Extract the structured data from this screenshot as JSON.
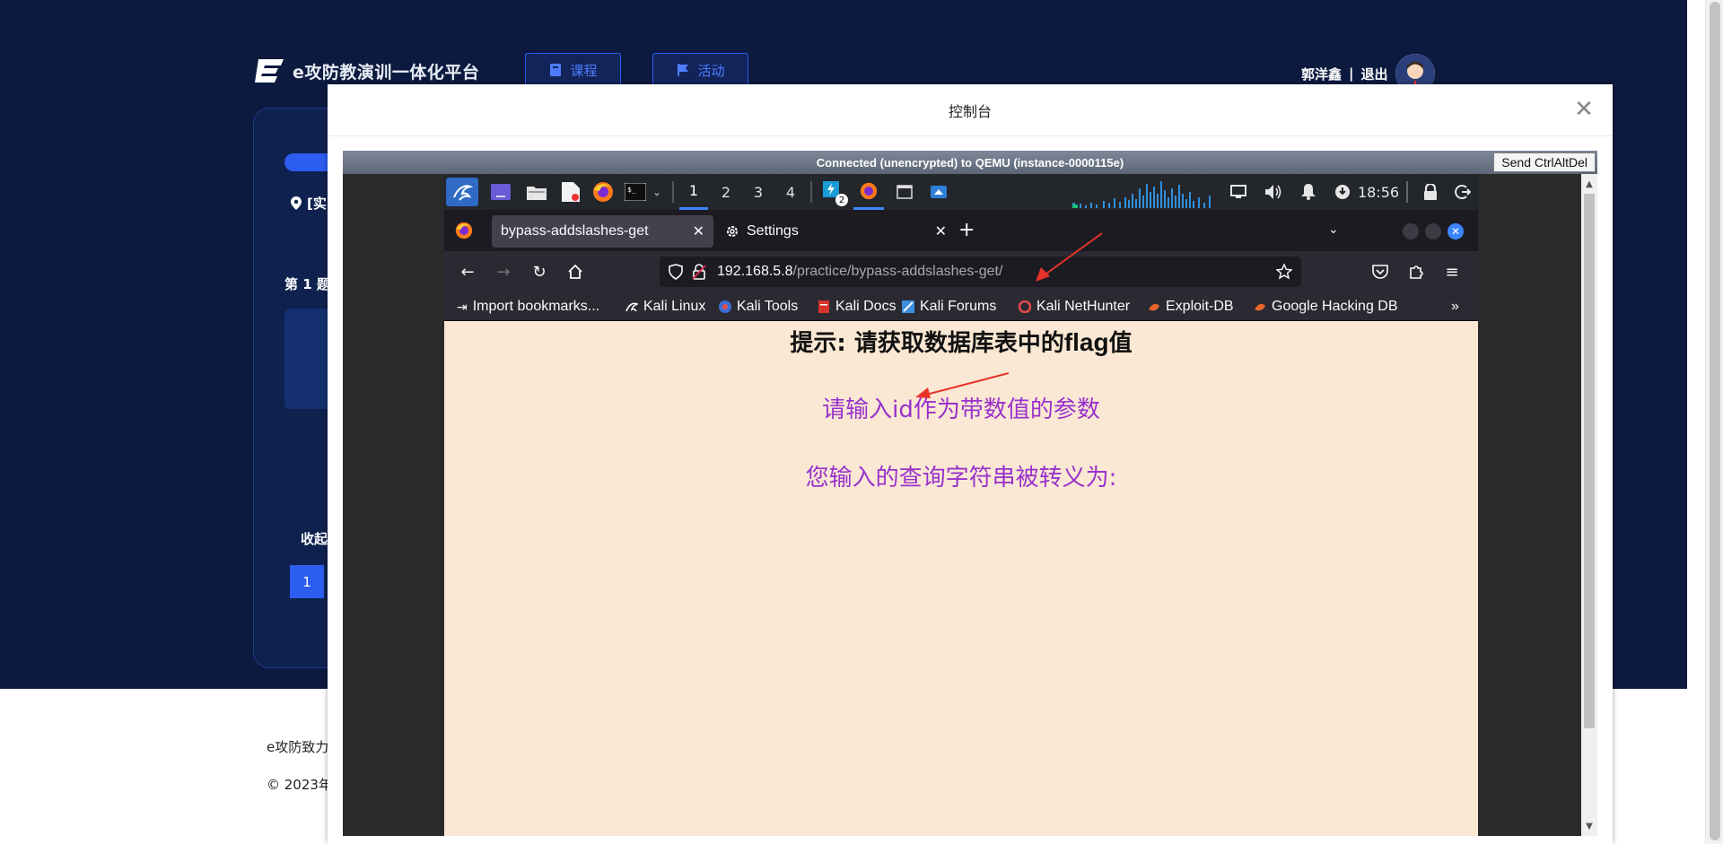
{
  "platform": {
    "logo_text": "e攻防教演训一体化平台",
    "nav": [
      {
        "label": "课程"
      },
      {
        "label": "活动"
      }
    ],
    "user_name": "郭洋鑫",
    "separator": "|",
    "logout": "退出",
    "location_text": "[实",
    "question_label": "第 1 题",
    "collapse_label": "收起",
    "page_number": "1",
    "footer_line1": "e攻防致力",
    "footer_line2": "© 2023年"
  },
  "modal": {
    "title": "控制台",
    "close_glyph": "✕"
  },
  "vnc": {
    "status": "Connected (unencrypted) to QEMU (instance-0000115e)",
    "ctrlaltdel_label": "Send CtrlAltDel"
  },
  "kali_panel": {
    "workspaces": [
      "1",
      "2",
      "3",
      "4"
    ],
    "active_workspace": "1",
    "notification_badge": "2",
    "clock": "18:56"
  },
  "firefox": {
    "tabs": [
      {
        "title": "bypass-addslashes-get",
        "active": true
      },
      {
        "title": "Settings",
        "active": false
      }
    ],
    "url_host": "192.168.5.8",
    "url_path": "/practice/bypass-addslashes-get/",
    "bookmarks": [
      "Import bookmarks...",
      "Kali Linux",
      "Kali Tools",
      "Kali Docs",
      "Kali Forums",
      "Kali NetHunter",
      "Exploit-DB",
      "Google Hacking DB"
    ]
  },
  "webpage": {
    "hint_prefix": "提示: 请获取数据库表中的",
    "hint_flag": "flag",
    "hint_suffix": "值",
    "prompt": "请输入id作为带数值的参数",
    "escaped_label": "您输入的查询字符串被转义为:"
  },
  "colors": {
    "platform_bg": "#0c1a3f",
    "accent_blue": "#2d5cf0",
    "page_bg": "#fbe8d4",
    "prompt_purple": "#9932cc",
    "arrow_red": "#e8332a"
  }
}
